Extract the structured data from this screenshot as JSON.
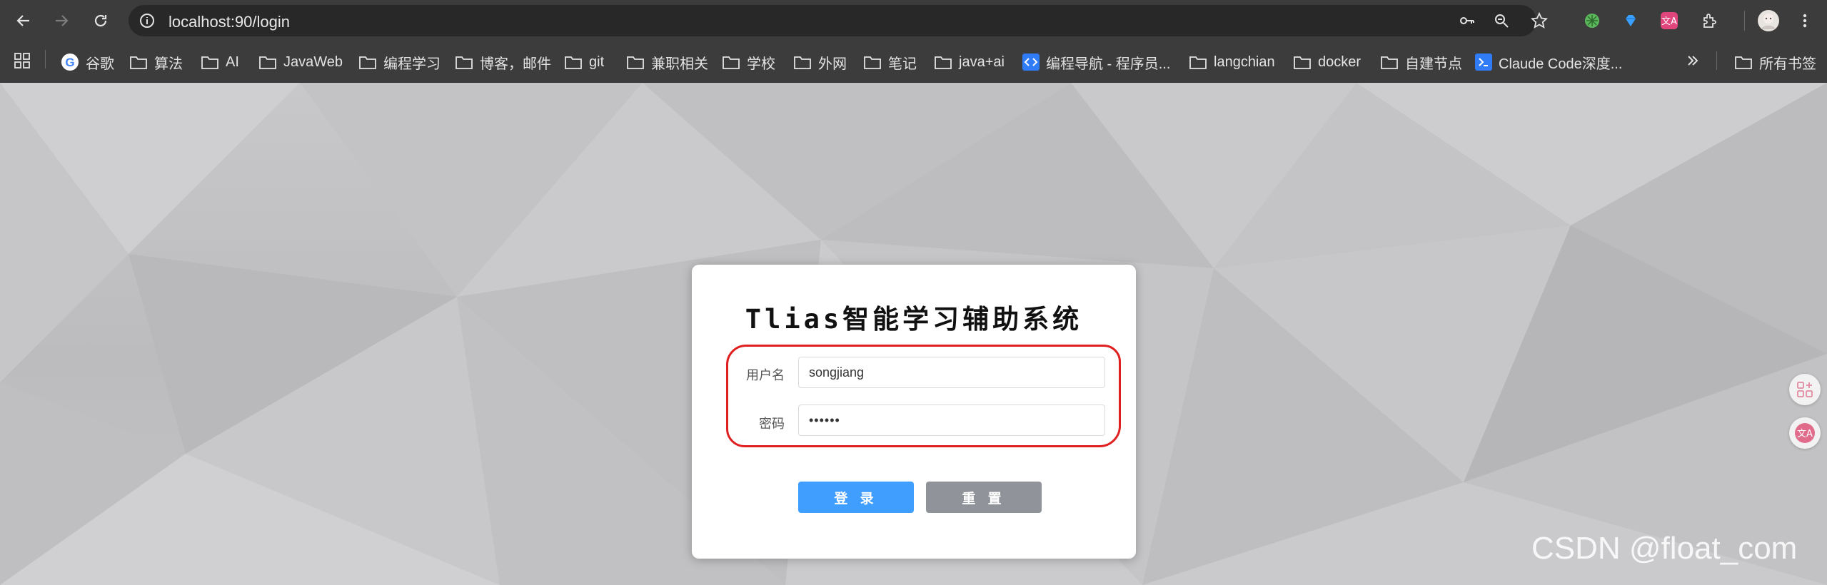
{
  "browser": {
    "url": "localhost:90/login",
    "bookmarks": [
      {
        "label": "谷歌",
        "icon": "google-icon"
      },
      {
        "label": "算法",
        "icon": "folder-icon"
      },
      {
        "label": "AI",
        "icon": "folder-icon"
      },
      {
        "label": "JavaWeb",
        "icon": "folder-icon"
      },
      {
        "label": "编程学习",
        "icon": "folder-icon"
      },
      {
        "label": "博客，邮件",
        "icon": "folder-icon"
      },
      {
        "label": "git",
        "icon": "folder-icon"
      },
      {
        "label": "兼职相关",
        "icon": "folder-icon"
      },
      {
        "label": "学校",
        "icon": "folder-icon"
      },
      {
        "label": "外网",
        "icon": "folder-icon"
      },
      {
        "label": "笔记",
        "icon": "folder-icon"
      },
      {
        "label": "java+ai",
        "icon": "folder-icon"
      },
      {
        "label": "编程导航 - 程序员...",
        "icon": "code-nav-icon"
      },
      {
        "label": "langchian",
        "icon": "folder-icon"
      },
      {
        "label": "docker",
        "icon": "folder-icon"
      },
      {
        "label": "自建节点",
        "icon": "folder-icon"
      },
      {
        "label": "Claude Code深度...",
        "icon": "terminal-icon"
      }
    ],
    "all_bookmarks_label": "所有书签"
  },
  "login": {
    "title": "Tlias智能学习辅助系统",
    "username_label": "用户名",
    "username_value": "songjiang",
    "password_label": "密码",
    "password_value": "••••••",
    "login_button": "登 录",
    "reset_button": "重 置"
  },
  "watermark": "CSDN @float_com",
  "colors": {
    "primary": "#409eff",
    "secondary": "#909399",
    "annotation": "#e02020"
  }
}
